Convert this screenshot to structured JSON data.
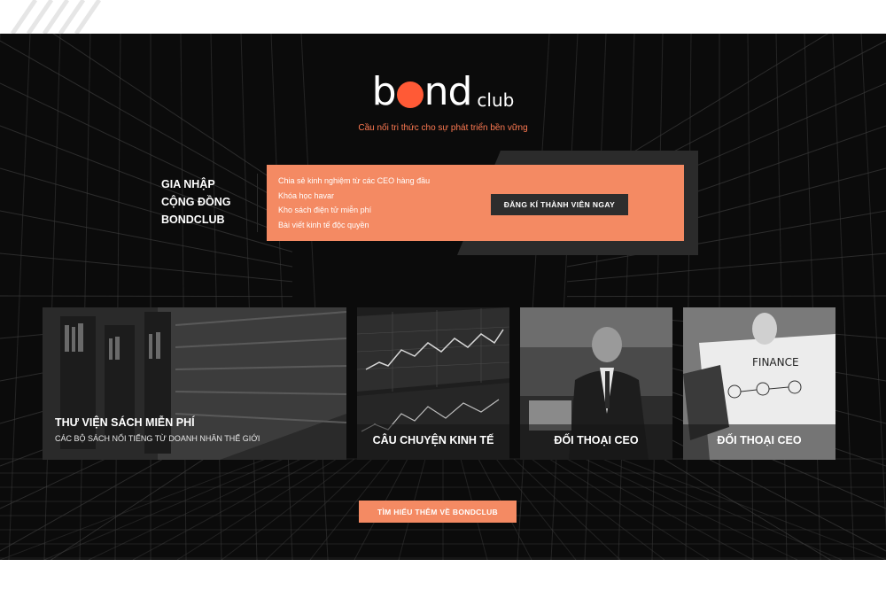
{
  "brand": {
    "logo_b": "b",
    "logo_nd": "nd",
    "logo_club": "club",
    "tagline": "Cầu nối tri thức cho sự phát triển bền vững",
    "accent_color": "#f48a63",
    "logo_dot_color": "#ff5a36"
  },
  "join": {
    "line1": "GIA NHẬP",
    "line2": "CỘNG ĐỒNG",
    "line3": "BONDCLUB"
  },
  "promo": {
    "benefits": [
      "Chia sẻ kinh nghiệm từ các CEO hàng đầu",
      "Khóa học havar",
      "Kho sách điện tử miễn phí",
      "Bài viết kinh tế độc quyền"
    ],
    "signup_label": "ĐĂNG KÍ THÀNH VIÊN NGAY"
  },
  "cards": [
    {
      "title": "THƯ VIỆN SÁCH MIỄN PHÍ",
      "subtitle": "CÁC BỘ SÁCH NỔI TIẾNG TỪ DOANH NHÂN THẾ GIỚI",
      "icon": "library-photo"
    },
    {
      "title": "CÂU CHUYỆN KINH TẾ",
      "icon": "stock-chart-photo"
    },
    {
      "title": "ĐỐI THOẠI CEO",
      "icon": "businessman-photo"
    },
    {
      "title": "ĐỐI THOẠI CEO",
      "icon": "finance-sketch-photo"
    }
  ],
  "more_label": "TÌM HIỂU THÊM VỀ BONDCLUB"
}
